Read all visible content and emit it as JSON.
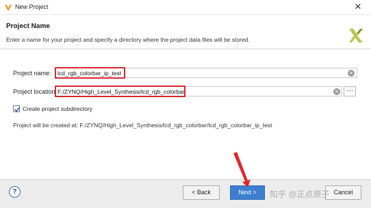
{
  "window": {
    "title": "New Project",
    "close_glyph": "✕"
  },
  "banner": {
    "heading": "Project Name",
    "description": "Enter a name for your project and specify a directory where the project data files will be stored.",
    "logo": "xilinx-logo-icon"
  },
  "form": {
    "name_label": "Project name:",
    "name_value": "lcd_rgb_colorbar_ip_test",
    "location_label": "Project location:",
    "location_value": "F:/ZYNQ/High_Level_Synthesis/lcd_rgb_colorbar",
    "browse_label": "···",
    "subdir_checked": true,
    "subdir_label": "Create project subdirectory",
    "created_at_text": "Project will be created at: F:/ZYNQ/High_Level_Synthesis/lcd_rgb_colorbar/lcd_rgb_colorbar_ip_test"
  },
  "footer": {
    "help_label": "?",
    "back_label": "< Back",
    "next_label": "Next >",
    "cancel_label": "Cancel"
  },
  "watermark": "知乎 @正点原子",
  "colors": {
    "highlight": "#d7262e",
    "next_button": "#3c7fd1"
  }
}
